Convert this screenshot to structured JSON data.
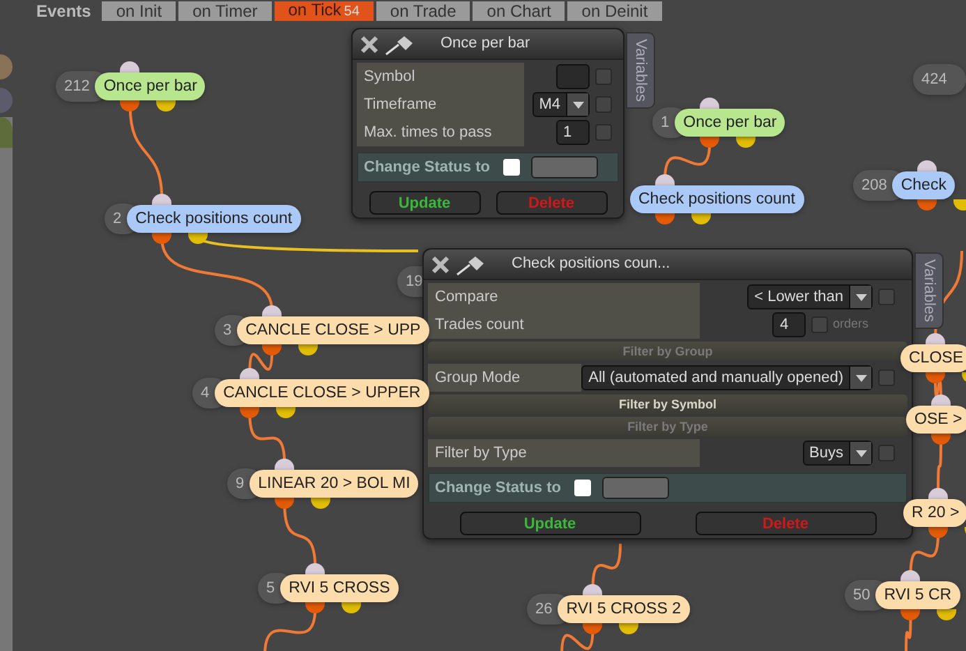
{
  "events_label": "Events",
  "tabs": [
    {
      "label": "on Init",
      "selected": false
    },
    {
      "label": "on Timer",
      "selected": false
    },
    {
      "label": "on Tick",
      "badge": "54",
      "selected": true
    },
    {
      "label": "on Trade",
      "selected": false
    },
    {
      "label": "on Chart",
      "selected": false
    },
    {
      "label": "on Deinit",
      "selected": false
    }
  ],
  "nodes": [
    {
      "number": "212",
      "label": "Once per bar",
      "color": "#b8e68e"
    },
    {
      "number": "2",
      "label": "Check positions count",
      "color": "#abc9f7"
    },
    {
      "number": "19"
    },
    {
      "number": "3",
      "label": "CANCLE CLOSE > UPP",
      "color": "#fddcab"
    },
    {
      "number": "4",
      "label": "CANCLE CLOSE > UPPER",
      "color": "#fddcab"
    },
    {
      "number": "9",
      "label": "LINEAR 20 > BOL MI",
      "color": "#fddcab"
    },
    {
      "number": "5",
      "label": "RVI 5 CROSS",
      "color": "#fddcab"
    },
    {
      "number": "26",
      "label": "RVI 5 CROSS 2",
      "color": "#fddcab"
    },
    {
      "number": "1",
      "label": "Once per bar",
      "color": "#b8e68e"
    },
    {
      "label": "Check positions count",
      "color": "#abc9f7"
    },
    {
      "number": "424"
    },
    {
      "number": "208",
      "label": "Check",
      "color": "#abc9f7"
    },
    {
      "label": "CLOSE",
      "color": "#fddcab"
    },
    {
      "label": "OSE >",
      "color": "#fddcab"
    },
    {
      "label": "R 20 >",
      "color": "#fddcab"
    },
    {
      "number": "50",
      "label": "RVI 5 CR",
      "color": "#fddcab"
    }
  ],
  "panels": [
    {
      "title": "Once per bar",
      "side_tab": "Variables",
      "rows": [
        {
          "kind": "field",
          "label": "Symbol",
          "checked": false
        },
        {
          "kind": "select",
          "label": "Timeframe",
          "value": "M4",
          "checked": false
        },
        {
          "kind": "field",
          "label": "Max. times to pass",
          "value": "1",
          "checked": false
        }
      ],
      "status": {
        "label": "Change Status to",
        "checked": false
      },
      "buttons": [
        {
          "kind": "update",
          "label": "Update"
        },
        {
          "kind": "delete",
          "label": "Delete"
        }
      ]
    },
    {
      "title": "Check positions coun...",
      "side_tab": "Variables",
      "rows": [
        {
          "kind": "select",
          "label": "Compare",
          "value": "< Lower than",
          "checked": false
        },
        {
          "kind": "field",
          "label": "Trades count",
          "value": "4",
          "checked": false,
          "unit": "orders"
        },
        {
          "kind": "section",
          "label": "Filter by Group",
          "expanded": true
        },
        {
          "kind": "select",
          "label": "Group Mode",
          "value": "All (automated and manually opened)",
          "checked": false
        },
        {
          "kind": "section",
          "label": "Filter by Symbol",
          "expanded": false
        },
        {
          "kind": "section",
          "label": "Filter by Type",
          "expanded": true
        },
        {
          "kind": "select",
          "label": "Filter by Type",
          "value": "Buys",
          "checked": false
        }
      ],
      "status": {
        "label": "Change Status to",
        "checked": false
      },
      "buttons": [
        {
          "kind": "update",
          "label": "Update"
        },
        {
          "kind": "delete",
          "label": "Delete"
        }
      ]
    }
  ]
}
